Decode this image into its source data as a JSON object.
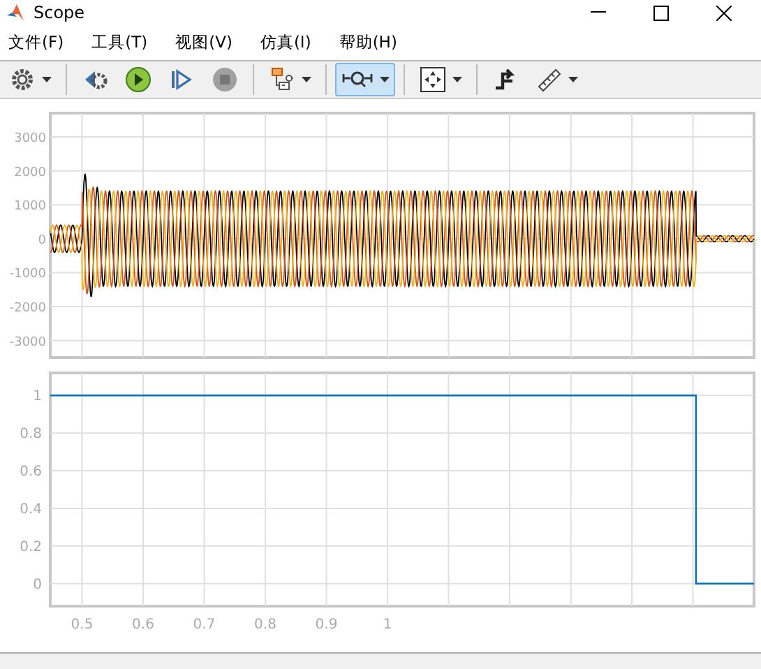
{
  "window": {
    "title": "Scope"
  },
  "menu": [
    "文件(F)",
    "工具(T)",
    "视图(V)",
    "仿真(I)",
    "帮助(H)"
  ],
  "toolbar": [
    {
      "kind": "settings",
      "caret": true,
      "selected": false
    },
    {
      "kind": "separator"
    },
    {
      "kind": "step-back",
      "caret": false,
      "selected": false
    },
    {
      "kind": "run",
      "caret": false,
      "selected": false
    },
    {
      "kind": "step-forward",
      "caret": false,
      "selected": false
    },
    {
      "kind": "stop",
      "caret": false,
      "selected": false
    },
    {
      "kind": "separator"
    },
    {
      "kind": "signals",
      "caret": true,
      "selected": false
    },
    {
      "kind": "separator"
    },
    {
      "kind": "highlight",
      "caret": true,
      "selected": true
    },
    {
      "kind": "separator"
    },
    {
      "kind": "fit",
      "caret": true,
      "selected": false
    },
    {
      "kind": "separator"
    },
    {
      "kind": "trigger",
      "caret": false,
      "selected": false
    },
    {
      "kind": "measure",
      "caret": true,
      "selected": false
    }
  ],
  "top_plot": {
    "ytick_labels": [
      "3000",
      "2000",
      "1000",
      "0",
      "-1000",
      "-2000",
      "-3000"
    ]
  },
  "bottom_plot": {
    "chart_data": {
      "type": "line",
      "x": [
        0.448,
        1.505,
        1.505,
        1.6
      ],
      "grid": true,
      "series": [
        {
          "color": "#0072bd",
          "values": [
            1,
            1,
            0,
            0
          ]
        }
      ],
      "xlim": [
        0.448,
        1.6
      ],
      "ylim": [
        -0.12,
        1.12
      ],
      "xticks": [
        0.5,
        0.6,
        0.7,
        0.8,
        0.9,
        {
          "value": 1,
          "label": "1"
        }
      ],
      "yticks": [
        0,
        0.2,
        0.4,
        0.6,
        0.8,
        {
          "value": 1,
          "label": "1"
        }
      ]
    }
  }
}
